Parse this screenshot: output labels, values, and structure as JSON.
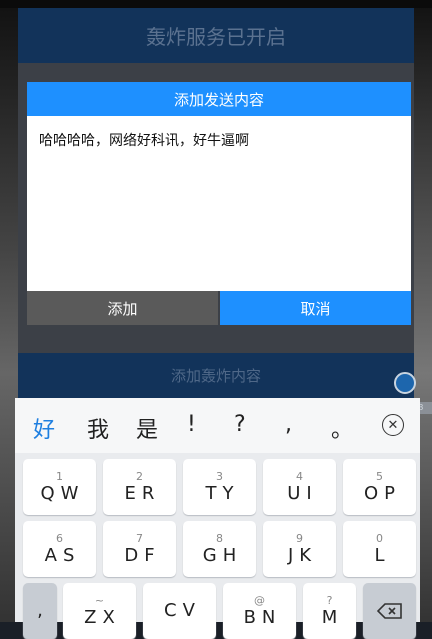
{
  "app": {
    "header_title": "轰炸服务已开启",
    "bomb_button": "添加轰炸内容",
    "tiny_label": "60.53"
  },
  "dialog": {
    "title": "添加发送内容",
    "input_value": "哈哈哈哈，网络好科讯，好牛逼啊",
    "add_label": "添加",
    "cancel_label": "取消"
  },
  "keyboard": {
    "candidates": [
      "好",
      "我",
      "是",
      "!",
      "?",
      ",",
      "。"
    ],
    "close_icon": "close-circle-icon",
    "rows": [
      [
        {
          "num": "1",
          "ltr": "QW"
        },
        {
          "num": "2",
          "ltr": "ER"
        },
        {
          "num": "3",
          "ltr": "TY"
        },
        {
          "num": "4",
          "ltr": "UI"
        },
        {
          "num": "5",
          "ltr": "OP"
        }
      ],
      [
        {
          "num": "6",
          "ltr": "AS"
        },
        {
          "num": "7",
          "ltr": "DF"
        },
        {
          "num": "8",
          "ltr": "GH"
        },
        {
          "num": "9",
          "ltr": "JK"
        },
        {
          "num": "0",
          "ltr": "L"
        }
      ],
      [
        {
          "num": "~",
          "ltr": "ZX"
        },
        {
          "num": "",
          "ltr": "CV"
        },
        {
          "num": "@",
          "ltr": "BN"
        },
        {
          "num": "?",
          "ltr": "M"
        }
      ]
    ],
    "comma_key": ",",
    "backspace_icon": "backspace-icon"
  }
}
